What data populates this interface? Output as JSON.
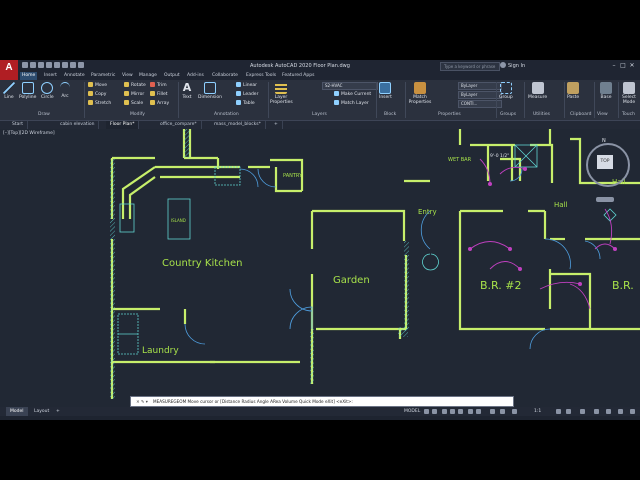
{
  "app": {
    "logo": "A",
    "title": "Autodesk AutoCAD 2020   Floor Plan.dwg",
    "search_placeholder": "Type a keyword or phrase",
    "sign_in": "Sign In",
    "window_controls": [
      "–",
      "□",
      "✕"
    ]
  },
  "ribbon_tabs": [
    {
      "label": "Home",
      "active": true
    },
    {
      "label": "Insert"
    },
    {
      "label": "Annotate"
    },
    {
      "label": "Parametric"
    },
    {
      "label": "View"
    },
    {
      "label": "Manage"
    },
    {
      "label": "Output"
    },
    {
      "label": "Add-ins"
    },
    {
      "label": "Collaborate"
    },
    {
      "label": "Express Tools"
    },
    {
      "label": "Featured Apps"
    }
  ],
  "ribbon": {
    "draw": {
      "line": "Line",
      "polyline": "Polyline",
      "circle": "Circle",
      "arc": "Arc",
      "panel": "Draw"
    },
    "modify": {
      "move": "Move",
      "rotate": "Rotate",
      "trim": "Trim",
      "copy": "Copy",
      "mirror": "Mirror",
      "fillet": "Fillet",
      "stretch": "Stretch",
      "scale": "Scale",
      "array": "Array",
      "panel": "Modify"
    },
    "annotation": {
      "text": "Text",
      "dimension": "Dimension",
      "linear": "Linear",
      "leader": "Leader",
      "table": "Table",
      "panel": "Annotation"
    },
    "layers": {
      "layer_properties": "Layer Properties",
      "current_layer": "S2-HVAC",
      "make_current": "Make Current",
      "match_layer": "Match Layer",
      "panel": "Layers"
    },
    "block": {
      "insert": "Insert",
      "panel": "Block"
    },
    "properties": {
      "match_properties": "Match Properties",
      "bylayer1": "ByLayer",
      "bylayer2": "ByLayer",
      "linetype": "CONTI...",
      "panel": "Properties"
    },
    "groups": {
      "group": "Group",
      "panel": "Groups"
    },
    "utilities": {
      "measure": "Measure",
      "panel": "Utilities"
    },
    "clipboard": {
      "paste": "Paste",
      "panel": "Clipboard"
    },
    "view": {
      "base": "Base",
      "panel": "View"
    },
    "touch": {
      "select_mode": "Select Mode",
      "panel": "Touch"
    }
  },
  "file_tabs": [
    {
      "label": "Start"
    },
    {
      "label": "cabin elevation"
    },
    {
      "label": "Floor Plan*",
      "active": true
    },
    {
      "label": "office_compare*"
    },
    {
      "label": "mass_model_blocks*"
    },
    {
      "label": "+"
    }
  ],
  "viewport_label": "[–][Top][2D Wireframe]",
  "viewcube": {
    "top": "TOP",
    "north": "N"
  },
  "drawing_labels": {
    "country_kitchen": "Country Kitchen",
    "island": "ISLAND",
    "pantry": "PANTRY",
    "garden": "Garden",
    "laundry": "Laundry",
    "entry": "Entry",
    "hall": "Hall",
    "hall2": "Hall",
    "br2": "B.R. #2",
    "br3": "B.R.",
    "wet_bar": "WET\nBAR",
    "dim": "9'-0 1/2\""
  },
  "command_line": {
    "prompt": "MEASUREGEOM Move cursor or [Distance Radius Angle ARea Volume Quick Mode eXit] <eXit>:"
  },
  "status_bar": {
    "tabs": [
      {
        "label": "Model",
        "active": true
      },
      {
        "label": "Layout"
      },
      {
        "label": "+"
      }
    ],
    "model_label": "MODEL",
    "scale": "1:1"
  },
  "colors": {
    "wall": "#c7ef6b",
    "hatch": "#5fd3d0",
    "door": "#4f9fe0",
    "text": "#a6e04a",
    "purple": "#c040c0",
    "ribbon_bg": "#2b313e",
    "canvas_bg": "#212834"
  }
}
